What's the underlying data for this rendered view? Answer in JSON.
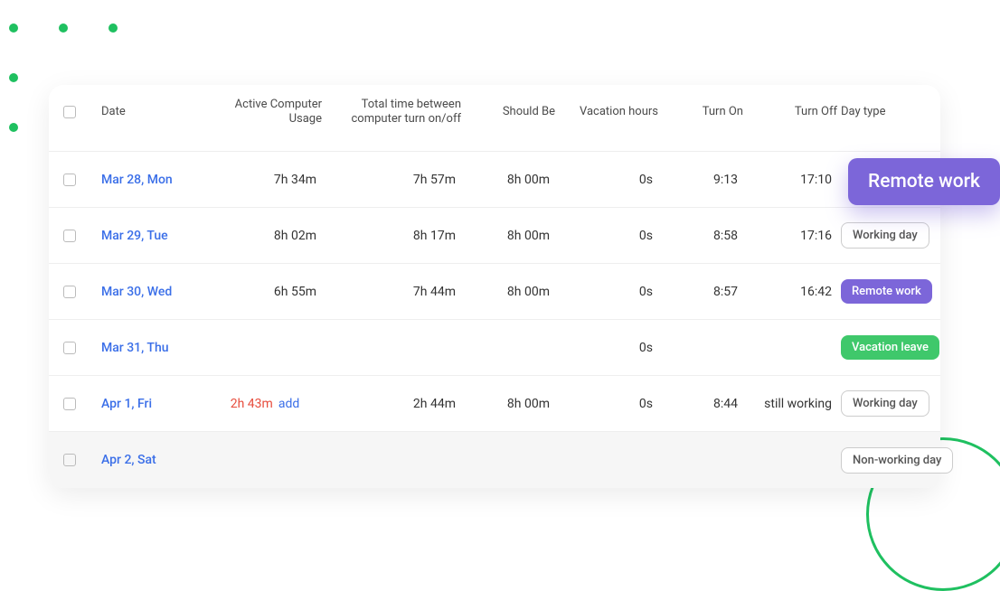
{
  "headers": {
    "date": "Date",
    "active": "Active Computer\nUsage",
    "total": "Total time between\ncomputer turn on/off",
    "should": "Should Be",
    "vacation": "Vacation hours",
    "on": "Turn On",
    "off": "Turn Off",
    "day": "Day type"
  },
  "rows": [
    {
      "date": "Mar 28, Mon",
      "active": "7h 34m",
      "total": "7h 57m",
      "should": "8h 00m",
      "vac": "0s",
      "on": "9:13",
      "off": "17:10",
      "day_label": "Remote work",
      "badge_class": "purple",
      "hide_day_in_row": true
    },
    {
      "date": "Mar 29, Tue",
      "active": "8h 02m",
      "total": "8h 17m",
      "should": "8h 00m",
      "vac": "0s",
      "on": "8:58",
      "off": "17:16",
      "day_label": "Working day",
      "badge_class": "outline"
    },
    {
      "date": "Mar 30, Wed",
      "active": "6h 55m",
      "total": "7h 44m",
      "should": "8h 00m",
      "vac": "0s",
      "on": "8:57",
      "off": "16:42",
      "day_label": "Remote work",
      "badge_class": "purple"
    },
    {
      "date": "Mar 31, Thu",
      "active": "",
      "total": "",
      "should": "",
      "vac": "0s",
      "on": "",
      "off": "",
      "day_label": "Vacation leave",
      "badge_class": "green"
    },
    {
      "date": "Apr 1, Fri",
      "active": "2h 43m",
      "active_red": true,
      "add": "add",
      "total": "2h 44m",
      "should": "8h 00m",
      "vac": "0s",
      "on": "8:44",
      "off": "still working",
      "day_label": "Working day",
      "badge_class": "outline"
    },
    {
      "date": "Apr 2, Sat",
      "active": "",
      "total": "",
      "should": "",
      "vac": "",
      "on": "",
      "off": "",
      "day_label": "Non-working day",
      "badge_class": "outline",
      "last": true
    }
  ],
  "highlight_badge": "Remote work"
}
